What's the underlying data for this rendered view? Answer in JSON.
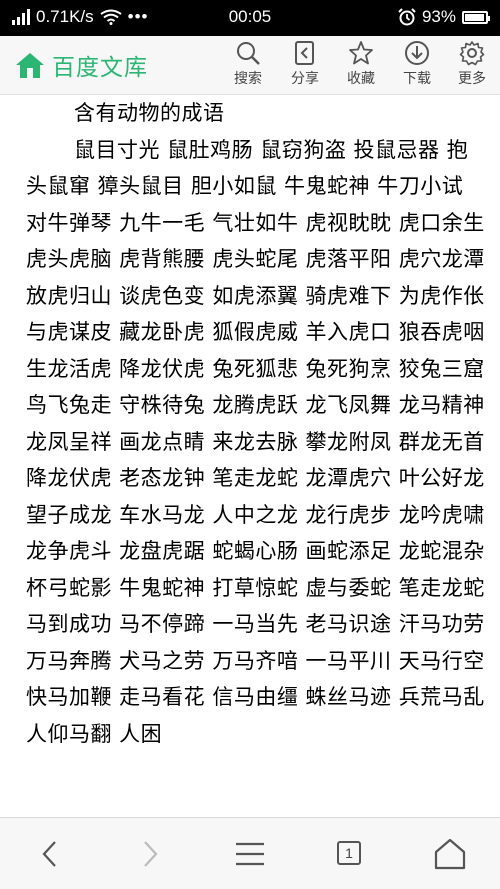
{
  "status_bar": {
    "net_speed": "0.71K/s",
    "time": "00:05",
    "battery": "93%",
    "battery_level": 0.93
  },
  "header": {
    "brand": "百度文库",
    "tools": [
      {
        "label": "搜索",
        "icon": "search-icon"
      },
      {
        "label": "分享",
        "icon": "share-icon"
      },
      {
        "label": "收藏",
        "icon": "star-icon"
      },
      {
        "label": "下载",
        "icon": "download-icon"
      },
      {
        "label": "更多",
        "icon": "gear-icon"
      }
    ]
  },
  "content": {
    "heading": "含有动物的成语",
    "body": "鼠目寸光 鼠肚鸡肠 鼠窃狗盗 投鼠忌器 抱头鼠窜 獐头鼠目 胆小如鼠 牛鬼蛇神 牛刀小试 对牛弹琴 九牛一毛 气壮如牛 虎视眈眈 虎口余生 虎头虎脑 虎背熊腰 虎头蛇尾 虎落平阳 虎穴龙潭 放虎归山 谈虎色变 如虎添翼 骑虎难下 为虎作伥 与虎谋皮 藏龙卧虎 狐假虎威 羊入虎口 狼吞虎咽 生龙活虎 降龙伏虎 兔死狐悲 兔死狗烹 狡兔三窟 鸟飞兔走 守株待兔 龙腾虎跃 龙飞凤舞 龙马精神 龙凤呈祥 画龙点睛 来龙去脉 攀龙附凤 群龙无首 降龙伏虎 老态龙钟 笔走龙蛇 龙潭虎穴 叶公好龙 望子成龙 车水马龙 人中之龙 龙行虎步 龙吟虎啸 龙争虎斗 龙盘虎踞 蛇蝎心肠 画蛇添足 龙蛇混杂 杯弓蛇影 牛鬼蛇神 打草惊蛇 虚与委蛇 笔走龙蛇 马到成功 马不停蹄 一马当先 老马识途 汗马功劳 万马奔腾 犬马之劳 万马齐喑 一马平川 天马行空 快马加鞭 走马看花 信马由缰 蛛丝马迹 兵荒马乱 人仰马翻 人困"
  },
  "bottom_nav": {
    "tab_count": "1"
  }
}
